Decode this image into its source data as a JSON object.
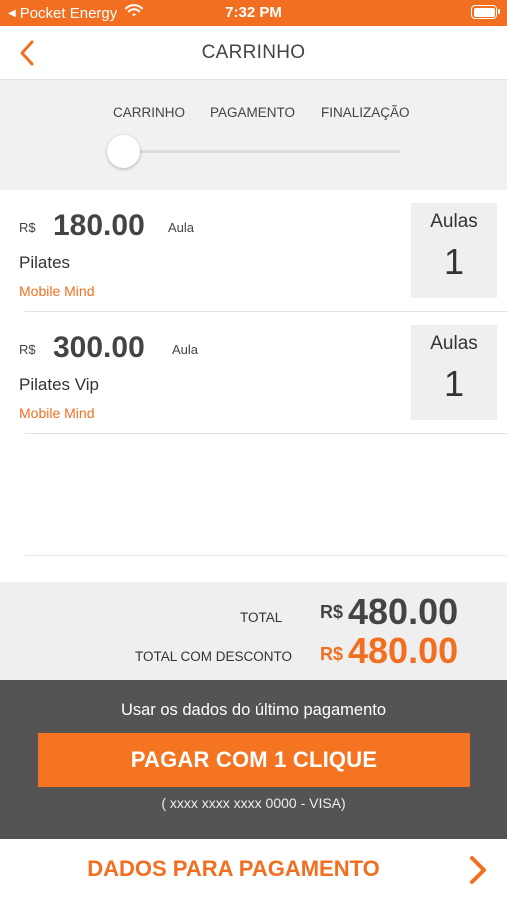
{
  "status_bar": {
    "carrier": "Pocket Energy",
    "time": "7:32 PM"
  },
  "nav": {
    "title": "CARRINHO"
  },
  "steps": {
    "labels": [
      "CARRINHO",
      "PAGAMENTO",
      "FINALIZAÇÃO"
    ],
    "current_step": 1
  },
  "cart": {
    "items": [
      {
        "currency": "R$",
        "price": "180.00",
        "unit": "Aula",
        "name": "Pilates",
        "vendor": "Mobile Mind",
        "qty_label": "Aulas",
        "qty": "1"
      },
      {
        "currency": "R$",
        "price": "300.00",
        "unit": "Aula",
        "name": "Pilates Vip",
        "vendor": "Mobile Mind",
        "qty_label": "Aulas",
        "qty": "1"
      }
    ]
  },
  "totals": {
    "total_label": "TOTAL",
    "total_currency": "R$",
    "total_value": "480.00",
    "discount_label": "TOTAL COM DESCONTO",
    "discount_currency": "R$",
    "discount_value": "480.00"
  },
  "one_click": {
    "hint": "Usar os dados do último pagamento",
    "button_label": "PAGAR COM 1 CLIQUE",
    "card": "( xxxx xxxx xxxx 0000 - VISA)"
  },
  "payment_data": {
    "label": "DADOS PARA PAGAMENTO"
  },
  "colors": {
    "accent": "#f26f21",
    "dark_panel": "#545454",
    "light_panel": "#efefef"
  },
  "icons": {
    "back": "chevron-left-icon",
    "forward": "chevron-right-icon",
    "wifi": "wifi-icon",
    "battery": "battery-icon"
  }
}
